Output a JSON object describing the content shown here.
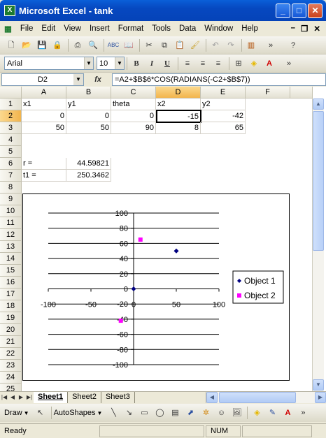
{
  "window": {
    "app_title": "Microsoft Excel - tank",
    "app_icon": "X"
  },
  "menu": [
    "File",
    "Edit",
    "View",
    "Insert",
    "Format",
    "Tools",
    "Data",
    "Window",
    "Help"
  ],
  "font_box": {
    "font": "Arial",
    "size": "10"
  },
  "format_buttons": {
    "bold": "B",
    "italic": "I",
    "underline": "U"
  },
  "formula_bar": {
    "name_box": "D2",
    "fx": "fx",
    "formula": "=A2+$B$6*COS(RADIANS(-C2+$B$7))"
  },
  "columns": [
    "A",
    "B",
    "C",
    "D",
    "E",
    "F"
  ],
  "rows": [
    "1",
    "2",
    "3",
    "4",
    "5",
    "6",
    "7",
    "8",
    "9",
    "10",
    "11",
    "12",
    "13",
    "14",
    "15",
    "16",
    "17",
    "18",
    "19",
    "20",
    "21",
    "22",
    "23",
    "24",
    "25"
  ],
  "cells": {
    "A1": "x1",
    "B1": "y1",
    "C1": "theta",
    "D1": "x2",
    "E1": "y2",
    "A2": "0",
    "B2": "0",
    "C2": "0",
    "D2": "-15",
    "E2": "-42",
    "A3": "50",
    "B3": "50",
    "C3": "90",
    "D3": "8",
    "E3": "65",
    "A6": "r =",
    "B6": "44.59821",
    "A7": "t1 =",
    "B7": "250.3462"
  },
  "chart_data": {
    "type": "scatter",
    "xlim": [
      -100,
      100
    ],
    "ylim": [
      -100,
      100
    ],
    "x_ticks": [
      "-100",
      "-50",
      "0",
      "50",
      "100"
    ],
    "y_ticks": [
      "100",
      "80",
      "60",
      "40",
      "20",
      "0",
      "-20",
      "-40",
      "-60",
      "-80",
      "-100"
    ],
    "grid": "horizontal",
    "legend_position": "right",
    "series": [
      {
        "name": "Object 1",
        "color": "#000080",
        "marker": "diamond",
        "points": [
          [
            0,
            0
          ],
          [
            50,
            50
          ]
        ]
      },
      {
        "name": "Object 2",
        "color": "#ff00ff",
        "marker": "square",
        "points": [
          [
            -15,
            -42
          ],
          [
            8,
            65
          ]
        ]
      }
    ]
  },
  "sheet_tabs": [
    "Sheet1",
    "Sheet2",
    "Sheet3"
  ],
  "draw_toolbar": {
    "draw": "Draw",
    "autoshapes": "AutoShapes"
  },
  "status": {
    "text": "Ready",
    "num": "NUM"
  }
}
